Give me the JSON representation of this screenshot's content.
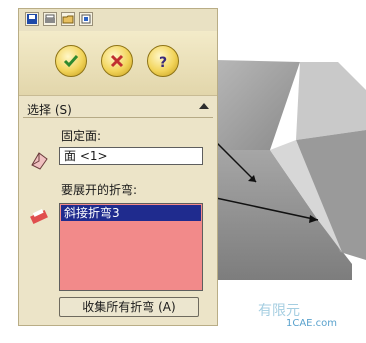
{
  "panel": {
    "section_title": "选择 (S)",
    "fixed_face_label": "固定面:",
    "fixed_face_value": "面 <1>",
    "bends_label": "要展开的折弯:",
    "bends_list": [
      "斜接折弯3"
    ],
    "collect_button": "收集所有折弯 (A)"
  },
  "toolbar": {
    "icons": [
      "save-icon",
      "print-icon",
      "open-icon",
      "options-icon"
    ]
  },
  "actions": {
    "ok_icon": "checkmark-icon",
    "cancel_icon": "close-icon",
    "help_icon": "help-icon"
  },
  "watermark": {
    "text": "有限元",
    "site": "1CAE.com"
  },
  "colors": {
    "panel_bg": "#ece4c8",
    "list_bg": "#f28a8a",
    "selection_bg": "#1f2b8e"
  }
}
